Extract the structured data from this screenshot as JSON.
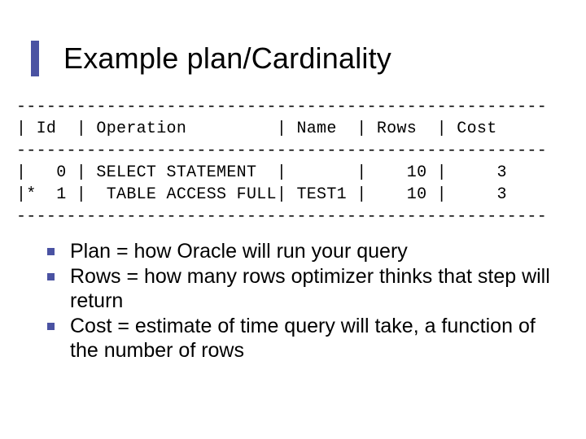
{
  "slide": {
    "title": "Example plan/Cardinality"
  },
  "plan": {
    "sep": "-----------------------------------------------------",
    "header": "| Id  | Operation         | Name  | Rows  | Cost",
    "rows": [
      "|   0 | SELECT STATEMENT  |       |    10 |     3",
      "|*  1 |  TABLE ACCESS FULL| TEST1 |    10 |     3"
    ]
  },
  "bullets": {
    "b1": "Plan = how Oracle will run your query",
    "b2": "Rows = how many rows optimizer thinks that step will return",
    "b3": "Cost = estimate of time query will take, a function of the number of rows"
  },
  "chart_data": {
    "type": "table",
    "title": "Execution plan",
    "columns": [
      "Id",
      "Operation",
      "Name",
      "Rows",
      "Cost"
    ],
    "rows": [
      {
        "Id": 0,
        "Operation": "SELECT STATEMENT",
        "Name": "",
        "Rows": 10,
        "Cost": 3,
        "predicate": false
      },
      {
        "Id": 1,
        "Operation": "TABLE ACCESS FULL",
        "Name": "TEST1",
        "Rows": 10,
        "Cost": 3,
        "predicate": true
      }
    ]
  }
}
